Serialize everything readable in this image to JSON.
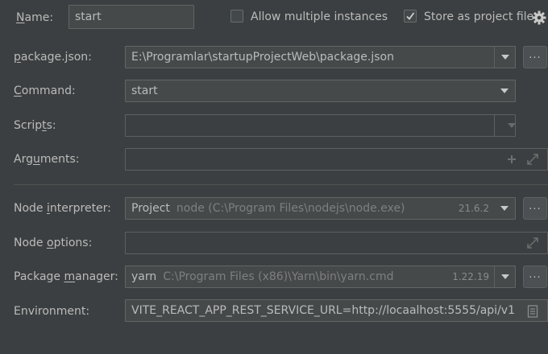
{
  "name": {
    "label": "Name:",
    "value": "start"
  },
  "allow_multiple": {
    "label": "Allow multiple instances",
    "checked": false
  },
  "store_project": {
    "label": "Store as project file",
    "checked": true
  },
  "package_json": {
    "label": "package.json:",
    "value": "E:\\Programlar\\startupProjectWeb\\package.json",
    "browse": "..."
  },
  "command": {
    "label": "Command:",
    "value": "start"
  },
  "scripts": {
    "label": "Scripts:",
    "value": ""
  },
  "arguments": {
    "label": "Arguments:",
    "value": ""
  },
  "node_interpreter": {
    "label": "Node interpreter:",
    "value": "Project",
    "detail": "node (C:\\Program Files\\nodejs\\node.exe)",
    "version": "21.6.2",
    "browse": "..."
  },
  "node_options": {
    "label": "Node options:",
    "value": ""
  },
  "package_manager": {
    "label": "Package manager:",
    "value": "yarn",
    "detail": "C:\\Program Files (x86)\\Yarn\\bin\\yarn.cmd",
    "version": "1.22.19",
    "browse": "..."
  },
  "environment": {
    "label": "Environment:",
    "value": "VITE_REACT_APP_REST_SERVICE_URL=http://locaalhost:5555/api/v1"
  },
  "icons": [
    "gear-icon",
    "plus-icon",
    "expand-icon",
    "document-icon",
    "chevron-down-icon",
    "checkmark-icon"
  ],
  "colors": {
    "background": "#3c3f41",
    "field_bg": "#45494a",
    "border": "#646464",
    "text": "#bbbbbb",
    "dim_text": "#7f7f7f"
  }
}
